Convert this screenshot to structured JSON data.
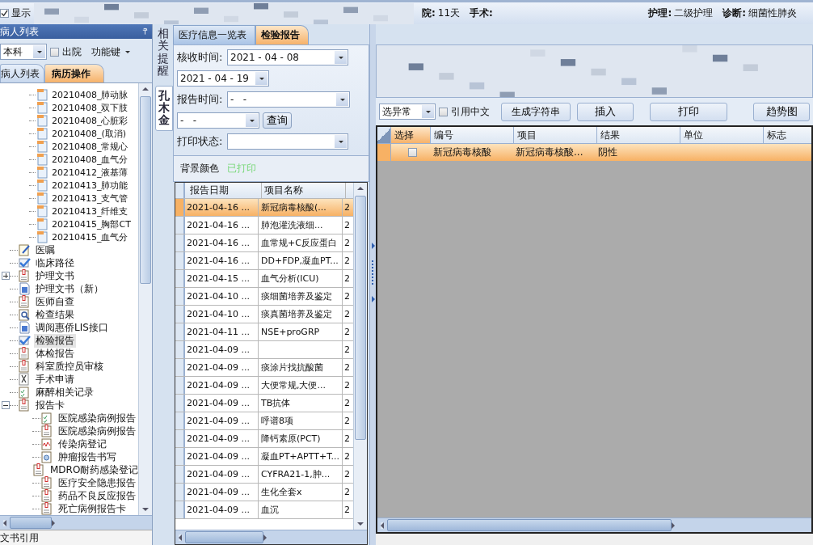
{
  "top_bar": {
    "show_checkbox": {
      "label": "显示",
      "checked": true
    },
    "stats": [
      {
        "label": "院:",
        "value": "11天"
      },
      {
        "label": "手术:"
      }
    ],
    "care": [
      {
        "label": "护理:",
        "value": "二级护理"
      },
      {
        "label": "诊断:",
        "value": "细菌性肺炎"
      }
    ]
  },
  "left_panel": {
    "title": "病人列表",
    "department": "本科",
    "discharged": {
      "label": "出院",
      "checked": false
    },
    "function_key": "功能键",
    "tabs": [
      {
        "label": "病人列表",
        "selected": false
      },
      {
        "label": "病历操作",
        "selected": true
      }
    ],
    "records": [
      {
        "label": "20210408_肺动脉"
      },
      {
        "label": "20210408_双下肢"
      },
      {
        "label": "20210408_心脏彩"
      },
      {
        "label": "20210408_(取消)"
      },
      {
        "label": "20210408_常规心"
      },
      {
        "label": "20210408_血气分"
      },
      {
        "label": "20210412_液基薄"
      },
      {
        "label": "20210413_肺功能"
      },
      {
        "label": "20210413_支气管"
      },
      {
        "label": "20210413_纤维支"
      },
      {
        "label": "20210415_胸部CT"
      },
      {
        "label": "20210415_血气分"
      }
    ],
    "tree": [
      {
        "label": "医嘱",
        "kind": "pencil",
        "selected": false
      },
      {
        "label": "临床路径",
        "kind": "check",
        "selected": false
      },
      {
        "label": "护理文书",
        "kind": "page",
        "selected": false,
        "expanded": false
      },
      {
        "label": "护理文书（新）",
        "kind": "bluedoc",
        "selected": false
      },
      {
        "label": "医师自查",
        "kind": "doc",
        "selected": false
      },
      {
        "label": "检查结果",
        "kind": "search",
        "selected": false
      },
      {
        "label": "调阅惠侨LIS接口",
        "kind": "bluedoc",
        "selected": false
      },
      {
        "label": "检验报告",
        "kind": "check",
        "selected": true
      },
      {
        "label": "体检报告",
        "kind": "doc",
        "selected": false
      },
      {
        "label": "科室质控员审核",
        "kind": "doc",
        "selected": false
      },
      {
        "label": "手术申请",
        "kind": "scissors",
        "selected": false
      },
      {
        "label": "麻醉相关记录",
        "kind": "list",
        "selected": false
      },
      {
        "label": "报告卡",
        "kind": "doc",
        "selected": false,
        "expanded": true,
        "children": [
          {
            "label": "医院感染病例报告",
            "kind": "list",
            "selected": false
          },
          {
            "label": "医院感染病例报告",
            "kind": "doc",
            "selected": false
          },
          {
            "label": "传染病登记",
            "kind": "wave",
            "selected": false
          },
          {
            "label": "肿瘤报告书写",
            "kind": "target",
            "selected": false
          },
          {
            "label": "MDRO耐药感染登记",
            "kind": "doc",
            "selected": false
          },
          {
            "label": "医疗安全隐患报告",
            "kind": "doc",
            "selected": false
          },
          {
            "label": "药品不良反应报告",
            "kind": "doc",
            "selected": false
          },
          {
            "label": "死亡病例报告卡",
            "kind": "doc",
            "selected": false
          }
        ]
      }
    ],
    "footer": "文书引用"
  },
  "side_tabs": [
    {
      "label": "相关提醒",
      "selected": false
    },
    {
      "label": "孔木金",
      "selected": true
    }
  ],
  "middle_panel": {
    "tabs": [
      {
        "label": "医疗信息一览表",
        "selected": false
      },
      {
        "label": "检验报告",
        "selected": true
      }
    ],
    "received_label": "核收时间:",
    "received_from": "2021 - 04 - 08",
    "received_to": "2021 - 04 - 19",
    "report_label": "报告时间:",
    "report_from": "-   -",
    "report_to": "-   -",
    "query_button": "查询",
    "print_label": "打印状态:",
    "legend": {
      "label": "背景颜色",
      "printed": "已打印"
    },
    "table": {
      "columns": [
        "报告日期",
        "项目名称"
      ],
      "rows": [
        {
          "date": "2021-04-16 ...",
          "name": "新冠病毒核酸(...",
          "column_3": "2",
          "selected": true
        },
        {
          "date": "2021-04-16 ...",
          "name": "肺泡灌洗液细...",
          "column_3": "2",
          "selected": false
        },
        {
          "date": "2021-04-16 ...",
          "name": "血常规+C反应蛋白",
          "column_3": "2",
          "selected": false
        },
        {
          "date": "2021-04-16 ...",
          "name": "DD+FDP,凝血PT...",
          "column_3": "2",
          "selected": false
        },
        {
          "date": "2021-04-15 ...",
          "name": "血气分析(ICU)",
          "column_3": "2",
          "selected": false
        },
        {
          "date": "2021-04-10 ...",
          "name": "痰细菌培养及鉴定",
          "column_3": "2",
          "selected": false
        },
        {
          "date": "2021-04-10 ...",
          "name": "痰真菌培养及鉴定",
          "column_3": "2",
          "selected": false
        },
        {
          "date": "2021-04-11 ...",
          "name": "NSE+proGRP",
          "column_3": "2",
          "selected": false
        },
        {
          "date": "2021-04-09 ...",
          "column_3": "2",
          "selected": false
        },
        {
          "date": "2021-04-09 ...",
          "name": "痰涂片找抗酸菌",
          "column_3": "2",
          "selected": false
        },
        {
          "date": "2021-04-09 ...",
          "name": "大便常规,大便...",
          "column_3": "2",
          "selected": false
        },
        {
          "date": "2021-04-09 ...",
          "name": "TB抗体",
          "column_3": "2",
          "selected": false
        },
        {
          "date": "2021-04-09 ...",
          "name": "呼谱8项",
          "column_3": "2",
          "selected": false
        },
        {
          "date": "2021-04-09 ...",
          "name": "降钙素原(PCT)",
          "column_3": "2",
          "selected": false
        },
        {
          "date": "2021-04-09 ...",
          "name": "凝血PT+APTT+T...",
          "column_3": "2",
          "selected": false
        },
        {
          "date": "2021-04-09 ...",
          "name": "CYFRA21-1,肿...",
          "column_3": "2",
          "selected": false
        },
        {
          "date": "2021-04-09 ...",
          "name": "生化全套x",
          "column_3": "2",
          "selected": false
        },
        {
          "date": "2021-04-09 ...",
          "name": "血沉",
          "column_3": "2",
          "selected": false
        }
      ]
    }
  },
  "right_panel": {
    "filter": "选异常",
    "quote_chinese": {
      "label": "引用中文",
      "checked": false
    },
    "buttons": [
      "生成字符串",
      "插入",
      "打印",
      "趋势图"
    ],
    "table": {
      "columns": [
        "选择",
        "编号",
        "项目",
        "结果",
        "单位",
        "标志"
      ],
      "rows": [
        {
          "checked": false,
          "selected": true,
          "code": "新冠病毒核酸",
          "item": "新冠病毒核酸...",
          "result": "阴性"
        }
      ]
    }
  }
}
